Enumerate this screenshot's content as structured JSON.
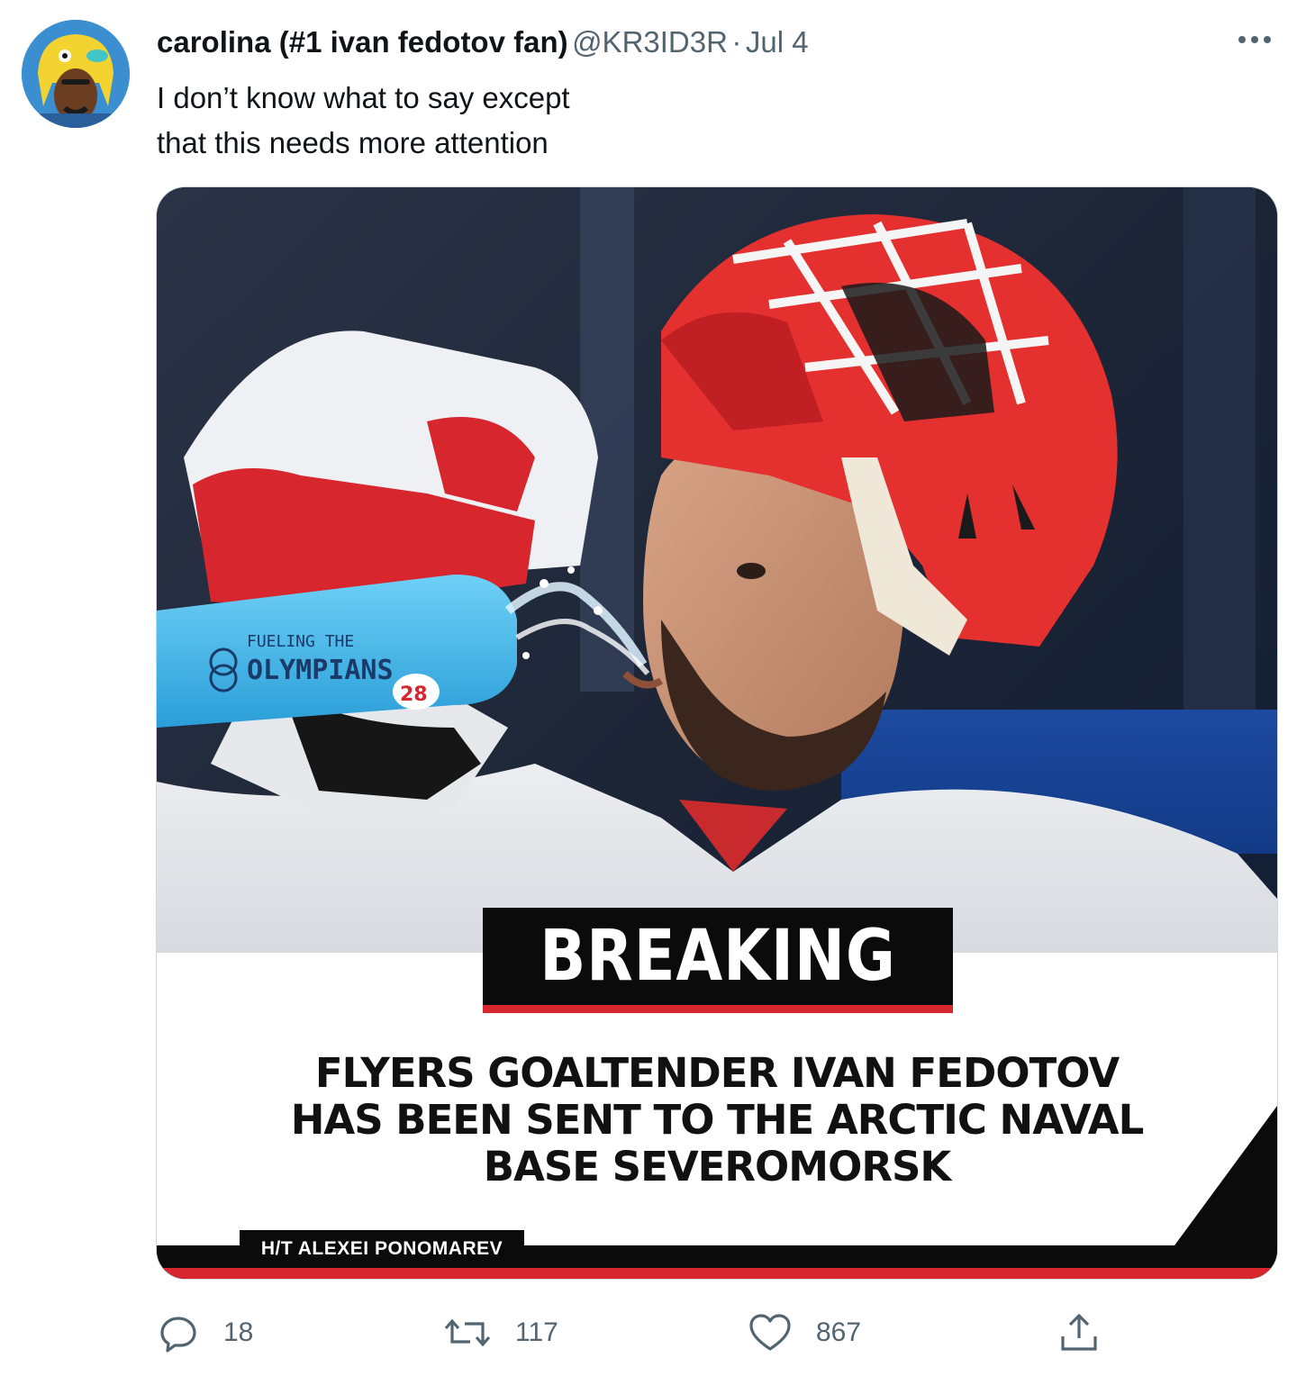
{
  "tweet": {
    "author_name": "carolina (#1 ivan fedotov fan)",
    "handle": "@KR3ID3R",
    "separator": "·",
    "time": "Jul 4",
    "text_line1": "I don’t know what to say except",
    "text_line2": "that this needs more attention"
  },
  "media": {
    "badge": "BREAKING",
    "headline_line1": "FLYERS GOALTENDER IVAN FEDOTOV",
    "headline_line2": "HAS BEEN SENT TO THE ARCTIC NAVAL",
    "headline_line3": "BASE SEVEROMORSK",
    "credit": "H/T ALEXEI PONOMAREV",
    "bottle_text": "OLYMPIANS",
    "bottle_top_text": "FUELING THE",
    "bottle_number": "28"
  },
  "actions": {
    "replies": "18",
    "retweets": "117",
    "likes": "867"
  },
  "colors": {
    "accent_red": "#d7262e",
    "helmet_red": "#e4312f",
    "muted_text": "#536471",
    "bottle_blue": "#3fb4ea"
  },
  "icons": [
    "more-icon",
    "reply-icon",
    "retweet-icon",
    "like-icon",
    "share-icon"
  ]
}
